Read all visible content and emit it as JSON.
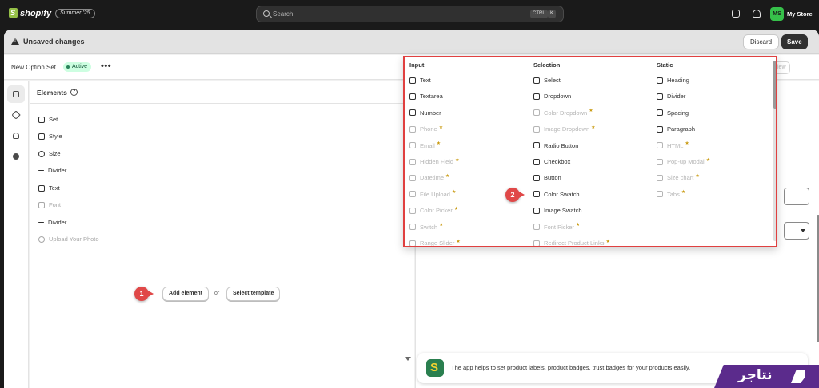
{
  "topbar": {
    "brand": "shopify",
    "edition": "Summer '25",
    "search_placeholder": "Search",
    "shortcut_keys": [
      "CTRL",
      "K"
    ],
    "avatar_initials": "MS",
    "store_name": "My Store"
  },
  "unsaved_bar": {
    "message": "Unsaved changes",
    "discard_label": "Discard",
    "save_label": "Save"
  },
  "page_header": {
    "title": "New Option Set",
    "status": "Active",
    "more_label": "•••",
    "preview_label": "iew"
  },
  "elements_panel": {
    "title": "Elements",
    "help_icon": "?",
    "items": [
      {
        "label": "Set",
        "enabled": true
      },
      {
        "label": "Style",
        "enabled": true
      },
      {
        "label": "Size",
        "enabled": true
      },
      {
        "label": "Divider",
        "enabled": true
      },
      {
        "label": "Text",
        "enabled": true
      },
      {
        "label": "Font",
        "enabled": false
      },
      {
        "label": "Divider",
        "enabled": true
      },
      {
        "label": "Upload Your Photo",
        "enabled": false
      }
    ],
    "add_element_label": "Add element",
    "or_label": "or",
    "select_template_label": "Select template"
  },
  "callouts": {
    "first": "1",
    "second": "2"
  },
  "popover": {
    "columns": [
      {
        "heading": "Input",
        "items": [
          {
            "label": "Text",
            "enabled": true,
            "premium": false
          },
          {
            "label": "Textarea",
            "enabled": true,
            "premium": false
          },
          {
            "label": "Number",
            "enabled": true,
            "premium": false
          },
          {
            "label": "Phone",
            "enabled": false,
            "premium": true
          },
          {
            "label": "Email",
            "enabled": false,
            "premium": true
          },
          {
            "label": "Hidden Field",
            "enabled": false,
            "premium": true
          },
          {
            "label": "Datetime",
            "enabled": false,
            "premium": true
          },
          {
            "label": "File Upload",
            "enabled": false,
            "premium": true
          },
          {
            "label": "Color Picker",
            "enabled": false,
            "premium": true
          },
          {
            "label": "Switch",
            "enabled": false,
            "premium": true
          },
          {
            "label": "Range Slider",
            "enabled": false,
            "premium": true
          }
        ]
      },
      {
        "heading": "Selection",
        "items": [
          {
            "label": "Select",
            "enabled": true,
            "premium": false
          },
          {
            "label": "Dropdown",
            "enabled": true,
            "premium": false
          },
          {
            "label": "Color Dropdown",
            "enabled": false,
            "premium": true
          },
          {
            "label": "Image Dropdown",
            "enabled": false,
            "premium": true
          },
          {
            "label": "Radio Button",
            "enabled": true,
            "premium": false
          },
          {
            "label": "Checkbox",
            "enabled": true,
            "premium": false
          },
          {
            "label": "Button",
            "enabled": true,
            "premium": false
          },
          {
            "label": "Color Swatch",
            "enabled": true,
            "premium": false
          },
          {
            "label": "Image Swatch",
            "enabled": true,
            "premium": false
          },
          {
            "label": "Font Picker",
            "enabled": false,
            "premium": true
          },
          {
            "label": "Redirect Product Links",
            "enabled": false,
            "premium": true
          }
        ]
      },
      {
        "heading": "Static",
        "items": [
          {
            "label": "Heading",
            "enabled": true,
            "premium": false
          },
          {
            "label": "Divider",
            "enabled": true,
            "premium": false
          },
          {
            "label": "Spacing",
            "enabled": true,
            "premium": false
          },
          {
            "label": "Paragraph",
            "enabled": true,
            "premium": false
          },
          {
            "label": "HTML",
            "enabled": false,
            "premium": true
          },
          {
            "label": "Pop-up Modal",
            "enabled": false,
            "premium": true
          },
          {
            "label": "Size chart",
            "enabled": false,
            "premium": true
          },
          {
            "label": "Tabs",
            "enabled": false,
            "premium": true
          }
        ]
      }
    ],
    "premium_marker": "★"
  },
  "promo": {
    "text": "The app helps to set product labels, product badges, trust badges for your products easily."
  },
  "badge": {
    "text": "نتاجر"
  },
  "colors": {
    "topbar": "#1a1a1a",
    "accent_active": "#36c04a",
    "callout": "#e04848",
    "premium_star": "#c99a10",
    "badge": "#5b2b8c"
  }
}
